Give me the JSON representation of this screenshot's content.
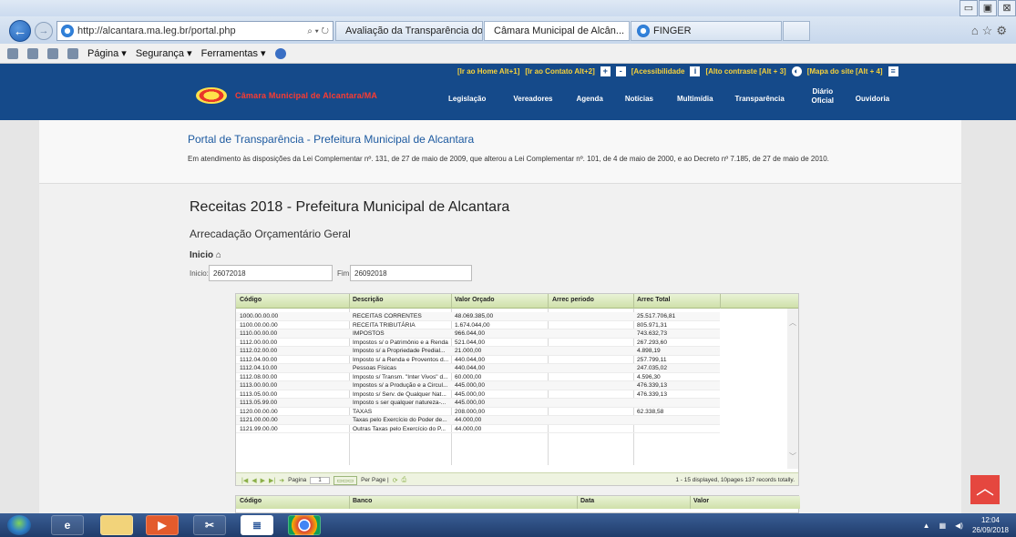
{
  "browser": {
    "window_controls": [
      "▭",
      "▣",
      "⊠"
    ],
    "address": "http://alcantara.ma.leg.br/portal.php",
    "search_icons": "⌕ ▾ ↻",
    "tabs": [
      {
        "label": "Avaliação da Transparência do..."
      },
      {
        "label": "Câmara Municipal de Alcân...",
        "close": "×"
      },
      {
        "label": "FINGER"
      }
    ],
    "right_icons": "⌂☆⚙",
    "toolbar": {
      "pagina": "Página ▾",
      "seguranca": "Segurança ▾",
      "ferramentas": "Ferramentas ▾"
    }
  },
  "site": {
    "top_links": {
      "home": "[Ir ao Home Alt+1]",
      "contato": "[Ir ao Contato Alt+2]",
      "plus": "+",
      "minus": "-",
      "acessibilidade": "[Acessibilidade",
      "contraste": "[Alto contraste [Alt + 3]",
      "mapa": "[Mapa do site [Alt + 4]"
    },
    "name": "Câmara Municipal de Alcantara/MA",
    "nav": [
      "Legislação",
      "Vereadores",
      "Agenda",
      "Notícias",
      "Multimídia",
      "Transparência",
      "Diário Oficial",
      "Ouvidoria"
    ]
  },
  "portal": {
    "title": "Portal de Transparência - Prefeitura Municipal de Alcantara",
    "intro": "Em atendimento às disposições da Lei Complementar nº. 131, de 27 de maio de 2009, que alterou a Lei Complementar nº. 101, de 4 de maio de 2000, e ao Decreto nº 7.185, de 27 de maio de 2010."
  },
  "page": {
    "title": "Receitas 2018 - Prefeitura Municipal de Alcantara",
    "subtitle": "Arrecadação Orçamentário Geral",
    "inicio_heading": "Inicio",
    "filter": {
      "inicio_label": "Inicio:",
      "inicio_value": "26072018",
      "fim_label": "Fim:",
      "fim_value": "26092018"
    }
  },
  "grid": {
    "columns": [
      "Código",
      "Descrição",
      "Valor Orçado",
      "Arrec periodo",
      "Arrec Total"
    ],
    "rows": [
      [
        "1000.00.00.00",
        "RECEITAS CORRENTES",
        "48.069.385,00",
        "",
        "25.517.706,81"
      ],
      [
        "1100.00.00.00",
        "RECEITA TRIBUTÁRIA",
        "1.674.044,00",
        "",
        "805.971,31"
      ],
      [
        "1110.00.00.00",
        "IMPOSTOS",
        "966.044,00",
        "",
        "743.632,73"
      ],
      [
        "1112.00.00.00",
        "Impostos s/ o Patrimônio e a Renda",
        "521.044,00",
        "",
        "267.293,60"
      ],
      [
        "1112.02.00.00",
        "Imposto s/ a Propriedade Predial...",
        "21.000,00",
        "",
        "4.898,19"
      ],
      [
        "1112.04.00.00",
        "Imposto s/ a Renda e Proventos d...",
        "440.044,00",
        "",
        "257.799,11"
      ],
      [
        "1112.04.10.00",
        "Pessoas Físicas",
        "440.044,00",
        "",
        "247.035,02"
      ],
      [
        "1112.08.00.00",
        "Imposto s/ Transm. \"Inter Vivos\" d...",
        "60.000,00",
        "",
        "4.596,30"
      ],
      [
        "1113.00.00.00",
        "Impostos s/ a Produção e a Circul...",
        "445.000,00",
        "",
        "476.339,13"
      ],
      [
        "1113.05.00.00",
        "Imposto s/ Serv. de Qualquer Nat...",
        "445.000,00",
        "",
        "476.339,13"
      ],
      [
        "1113.05.99.00",
        "Imposto s ser qualquer natureza-...",
        "445.000,00",
        "",
        ""
      ],
      [
        "1120.00.00.00",
        "TAXAS",
        "208.000,00",
        "",
        "62.338,58"
      ],
      [
        "1121.00.00.00",
        "Taxas pelo Exercício do Poder de...",
        "44.000,00",
        "",
        ""
      ],
      [
        "1121.99.00.00",
        "Outras Taxas pelo Exercício do P...",
        "44.000,00",
        "",
        ""
      ]
    ],
    "pager": {
      "pagina_label": "Pagina",
      "page_value": "1",
      "per_page": "Per Page |",
      "info": "1 - 15 displayed, 10pages 137 records totally."
    }
  },
  "grid2": {
    "columns": [
      "Código",
      "Banco",
      "Data",
      "Valor"
    ]
  },
  "taskbar": {
    "time": "12:04",
    "date": "26/09/2018"
  }
}
